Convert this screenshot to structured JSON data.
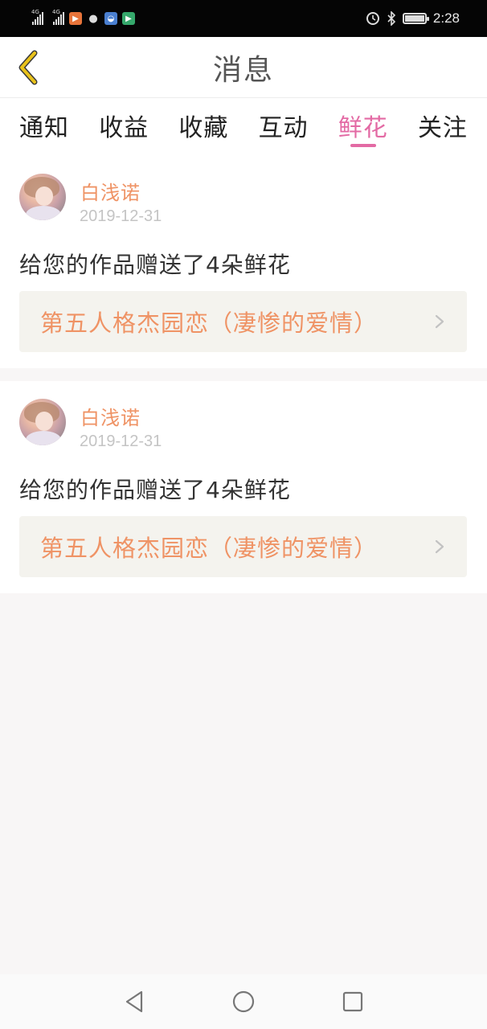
{
  "status_bar": {
    "network_1": "4G",
    "network_2": "4G",
    "time": "2:28",
    "icons": [
      "signal-icon",
      "signal-icon",
      "video-app-icon",
      "wechat-icon",
      "app-icon",
      "play-store-icon",
      "alarm-icon",
      "bluetooth-icon",
      "battery-icon"
    ]
  },
  "header": {
    "title": "消息",
    "back_icon": "chevron-left-icon"
  },
  "tabs": [
    {
      "label": "通知"
    },
    {
      "label": "收益"
    },
    {
      "label": "收藏"
    },
    {
      "label": "互动"
    },
    {
      "label": "鲜花",
      "active": true
    },
    {
      "label": "关注"
    }
  ],
  "messages": [
    {
      "username": "白浅诺",
      "date": "2019-12-31",
      "text": "给您的作品赠送了4朵鲜花",
      "work_title": "第五人格杰园恋（凄惨的爱情）"
    },
    {
      "username": "白浅诺",
      "date": "2019-12-31",
      "text": "给您的作品赠送了4朵鲜花",
      "work_title": "第五人格杰园恋（凄惨的爱情）"
    }
  ],
  "colors": {
    "accent_pink": "#e36aa4",
    "username_orange": "#ef9365",
    "link_bg": "#f4f3ee",
    "back_icon_yellow": "#e9c21a"
  }
}
